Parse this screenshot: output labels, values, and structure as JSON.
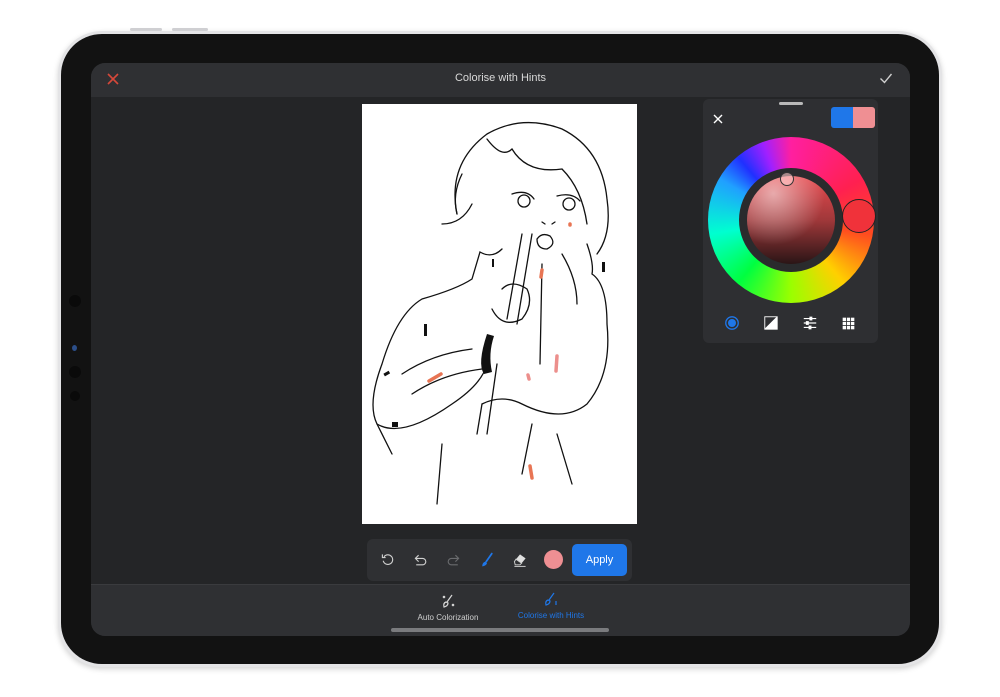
{
  "header": {
    "title": "Colorise with Hints",
    "close_icon": "close-icon",
    "confirm_icon": "checkmark-icon"
  },
  "colors": {
    "accent": "#1f77e9",
    "close": "#d6483a",
    "selected_color": "#ef8f93",
    "primary_swatch": "#1f77e9",
    "hue_knob": "#f0323a",
    "hint_orange": "#e87554",
    "hint_pink": "#ec8f8c"
  },
  "color_picker": {
    "close_icon": "close-icon",
    "swatches": [
      "#1f77e9",
      "#ef8f93"
    ],
    "modes": [
      {
        "icon": "disc-mode-icon",
        "active": true
      },
      {
        "icon": "classic-mode-icon",
        "active": false
      },
      {
        "icon": "sliders-mode-icon",
        "active": false
      },
      {
        "icon": "palette-grid-icon",
        "active": false
      }
    ]
  },
  "toolbar": {
    "tools": [
      {
        "icon": "reset-icon",
        "enabled": true
      },
      {
        "icon": "undo-icon",
        "enabled": true
      },
      {
        "icon": "redo-icon",
        "enabled": false
      },
      {
        "icon": "brush-icon",
        "active": true
      },
      {
        "icon": "eraser-icon",
        "enabled": true
      }
    ],
    "apply_label": "Apply"
  },
  "bottom_tabs": [
    {
      "label": "Auto Colorization",
      "icon": "magic-brush-icon",
      "active": false
    },
    {
      "label": "Colorise with Hints",
      "icon": "hint-brush-icon",
      "active": true
    }
  ]
}
